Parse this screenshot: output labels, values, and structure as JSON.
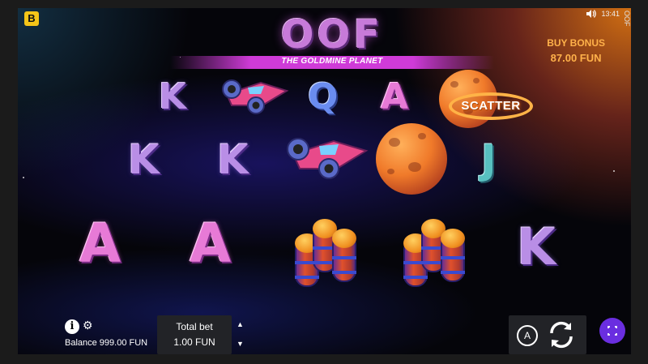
{
  "header": {
    "brand_mark": "B",
    "title": "OOF",
    "subtitle": "THE GOLDMINE PLANET",
    "clock": "13:41",
    "vertical_label": "OOF"
  },
  "buy_bonus": {
    "label": "BUY BONUS",
    "value": "87.00 FUN"
  },
  "reels": {
    "row1": [
      "K",
      "Q",
      "A"
    ],
    "row2": [
      "K",
      "K",
      "J"
    ],
    "row3": [
      "A",
      "A",
      "K"
    ],
    "scatter_label": "SCATTER",
    "symbol_icons": [
      "spaceship-icon",
      "planet-icon",
      "oxygen-tank-icon",
      "scatter-icon"
    ]
  },
  "footer": {
    "balance_label": "Balance 999.00 FUN",
    "total_bet_label": "Total bet",
    "total_bet_value": "1.00 FUN",
    "auto_label": "A"
  },
  "colors": {
    "accent": "#ffb14a",
    "fullscreen_button": "#6a2ee0",
    "brand": "#f5c518"
  }
}
